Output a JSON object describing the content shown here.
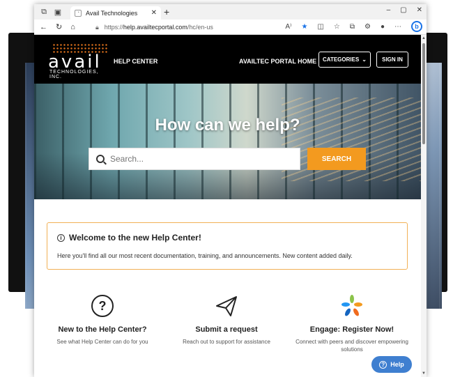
{
  "browser": {
    "tab_title": "Avail Technologies",
    "new_tab": "+",
    "url_prefix": "https://",
    "url_host": "help.availtecportal.com",
    "url_path": "/hc/en-us",
    "win_minimize": "–",
    "win_maximize": "▢",
    "win_close": "✕"
  },
  "site": {
    "logo_word": "avail",
    "logo_sub": "TECHNOLOGIES, INC.",
    "help_center": "HELP CENTER",
    "portal_home": "AVAILTEC PORTAL HOME",
    "categories": "CATEGORIES",
    "sign_in": "SIGN IN"
  },
  "hero": {
    "title": "How can we help?",
    "search_placeholder": "Search...",
    "search_button": "SEARCH"
  },
  "welcome": {
    "title": "Welcome to the new Help Center!",
    "text": "Here you'll find all our most recent documentation, training, and announcements. New content added daily."
  },
  "features": [
    {
      "title": "New to the Help Center?",
      "desc": "See what Help Center can do for you",
      "icon": "question-circle-icon"
    },
    {
      "title": "Submit a request",
      "desc": "Reach out to support for assistance",
      "icon": "paper-plane-icon"
    },
    {
      "title": "Engage: Register Now!",
      "desc": "Connect with peers and discover empowering solutions",
      "icon": "engage-logo-icon"
    }
  ],
  "help_widget": {
    "label": "Help"
  },
  "colors": {
    "accent_orange": "#f39a1f",
    "header_black": "#000000",
    "help_blue": "#3f7fd0",
    "welcome_border": "#f2b055"
  }
}
